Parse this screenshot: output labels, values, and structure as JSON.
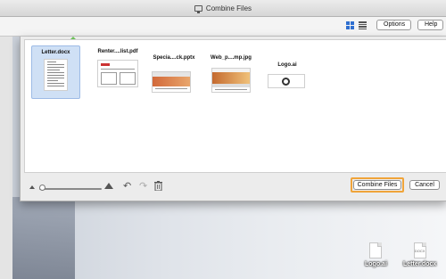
{
  "window": {
    "title": "Combine Files"
  },
  "toolbar": {
    "view_grid_icon": "grid-view-icon",
    "view_list_icon": "list-view-icon",
    "options_label": "Options",
    "help_label": "Help"
  },
  "files": [
    {
      "name": "Letter.docx",
      "selected": true,
      "kind": "document"
    },
    {
      "name": "Renter....list.pdf",
      "selected": false,
      "kind": "pdf"
    },
    {
      "name": "Specia....ck.pptx",
      "selected": false,
      "kind": "slides"
    },
    {
      "name": "Web_p....mp.jpg",
      "selected": false,
      "kind": "image"
    },
    {
      "name": "Logo.ai",
      "selected": false,
      "kind": "logo"
    }
  ],
  "bottombar": {
    "thumbnail_size": 0,
    "undo_icon": "undo-icon",
    "redo_icon": "redo-icon",
    "trash_icon": "trash-icon",
    "combine_label": "Combine Files",
    "cancel_label": "Cancel"
  },
  "desktop_files": [
    {
      "label": "Logo.ai",
      "ext": ""
    },
    {
      "label": "Letter.docx",
      "ext": "DOCX"
    }
  ],
  "colors": {
    "accent": "#2f6fd0",
    "highlight": "#f0a43a",
    "selection": "#cfe0f5"
  }
}
